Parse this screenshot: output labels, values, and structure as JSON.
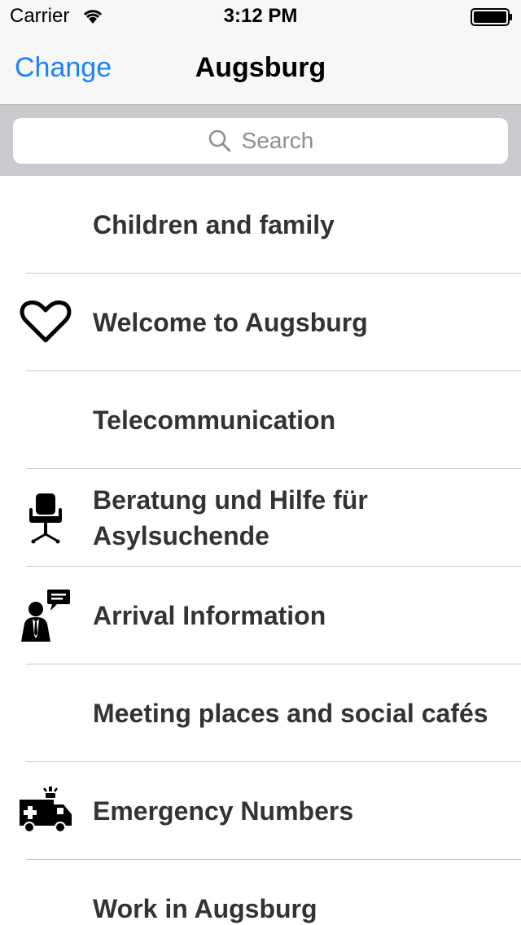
{
  "status_bar": {
    "carrier": "Carrier",
    "time": "3:12 PM",
    "wifi_icon": "wifi-icon",
    "battery_icon": "battery-full-icon"
  },
  "nav_bar": {
    "back_label": "Change",
    "title": "Augsburg",
    "tint_color": "#1a82fb"
  },
  "search": {
    "placeholder": "Search",
    "icon": "search-icon"
  },
  "items": [
    {
      "label": "Children and family",
      "icon": null
    },
    {
      "label": "Welcome to Augsburg",
      "icon": "heart-icon"
    },
    {
      "label": "Telecommunication",
      "icon": null
    },
    {
      "label": "Beratung und Hilfe für Asylsuchende",
      "icon": "office-chair-icon"
    },
    {
      "label": "Arrival Information",
      "icon": "person-speech-bubble-icon"
    },
    {
      "label": "Meeting places and social cafés",
      "icon": null
    },
    {
      "label": "Emergency Numbers",
      "icon": "ambulance-icon"
    },
    {
      "label": "Work in Augsburg",
      "icon": null
    }
  ]
}
